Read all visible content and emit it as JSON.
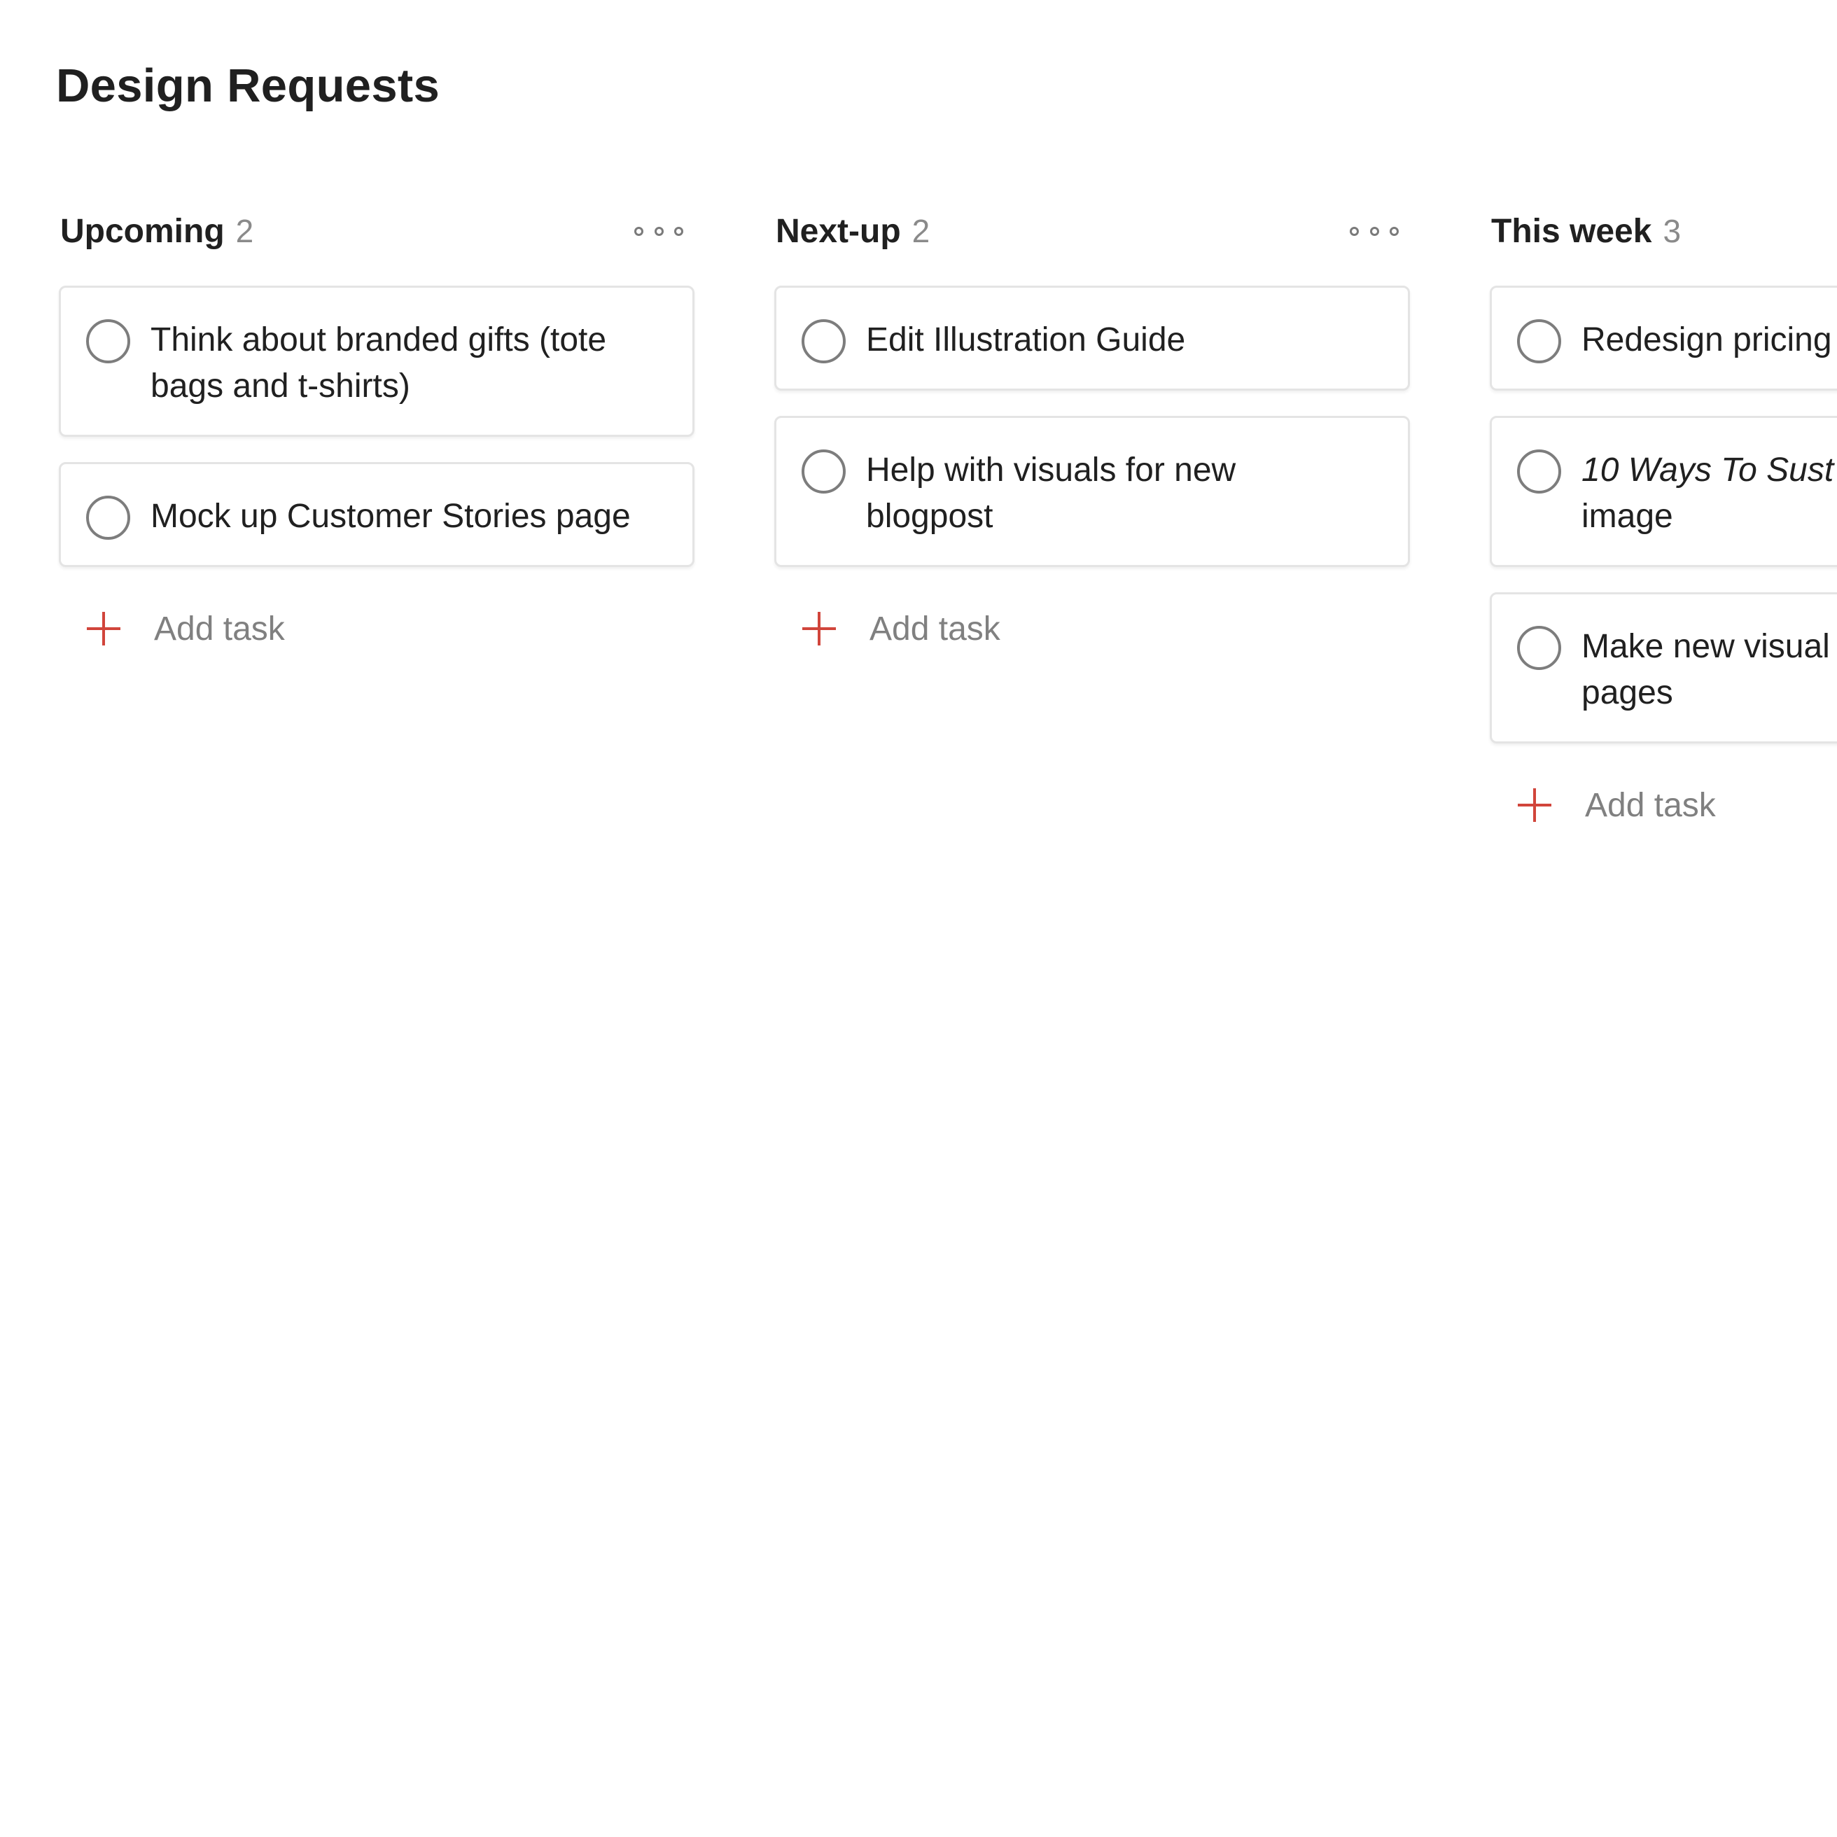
{
  "page": {
    "title": "Design Requests"
  },
  "columns": [
    {
      "title": "Upcoming",
      "count": "2",
      "more_icon": "more-horizontal-icon",
      "tasks": [
        {
          "text": "Think about branded gifts (tote\nbags and t-shirts)"
        },
        {
          "text": "Mock up Customer Stories page"
        }
      ],
      "add_label": "Add task"
    },
    {
      "title": "Next-up",
      "count": "2",
      "more_icon": "more-horizontal-icon",
      "tasks": [
        {
          "text": "Edit Illustration Guide"
        },
        {
          "text": "Help with visuals for new\nblogpost"
        }
      ],
      "add_label": "Add task"
    },
    {
      "title": "This week",
      "count": "3",
      "tasks": [
        {
          "text": "Redesign pricing"
        },
        {
          "text_italic": "10 Ways To Sust",
          "text": "\nimage"
        },
        {
          "text": "Make new visual\npages"
        }
      ],
      "add_label": "Add task"
    }
  ],
  "colors": {
    "accent": "#d1453b",
    "text": "#202020",
    "muted": "#808080",
    "card_border": "#e4e4e4"
  }
}
